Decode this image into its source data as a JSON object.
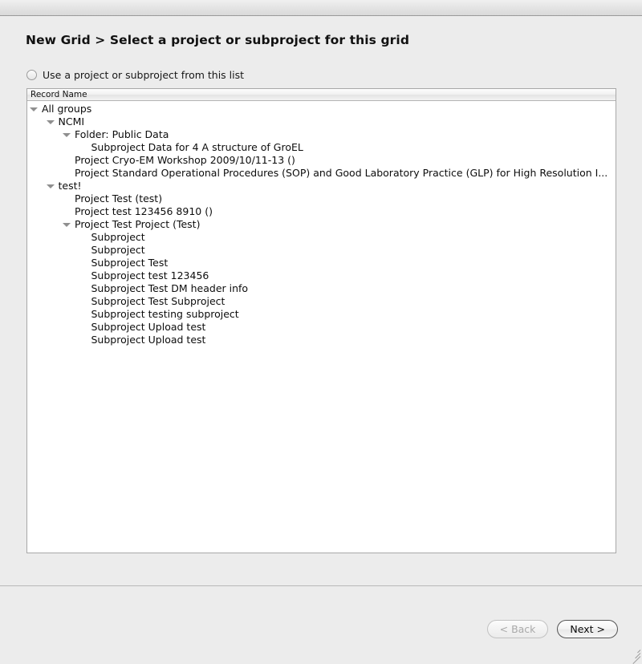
{
  "window": {
    "titlebar_visible": true
  },
  "header": {
    "title": "New Grid > Select a project or subproject for this grid"
  },
  "radio_option": {
    "label": "Use a project or subproject from this list",
    "selected": false,
    "icon": "radio-unchecked-icon"
  },
  "list": {
    "column_header": "Record Name",
    "rows": [
      {
        "label": "All groups",
        "level": 0,
        "expander": "triangle-down-icon",
        "expanded": true
      },
      {
        "label": "NCMI",
        "level": 1,
        "expander": "triangle-down-icon",
        "expanded": true
      },
      {
        "label": "Folder: Public Data",
        "level": 2,
        "expander": "triangle-down-icon",
        "expanded": true
      },
      {
        "label": "Subproject Data for 4 A structure of GroEL",
        "level": 3,
        "expander": "none",
        "expanded": false
      },
      {
        "label": "Project Cryo-EM Workshop 2009/10/11-13 ()",
        "level": 2,
        "expander": "none",
        "expanded": false
      },
      {
        "label": "Project Standard Operational Procedures (SOP) and Good Laboratory Practice (GLP) for High Resolution I...",
        "level": 2,
        "expander": "none",
        "expanded": false
      },
      {
        "label": "test!",
        "level": 1,
        "expander": "triangle-down-icon",
        "expanded": true
      },
      {
        "label": "Project Test (test)",
        "level": 2,
        "expander": "none",
        "expanded": false
      },
      {
        "label": "Project test 123456 8910 ()",
        "level": 2,
        "expander": "none",
        "expanded": false
      },
      {
        "label": "Project Test Project (Test)",
        "level": 2,
        "expander": "triangle-down-icon",
        "expanded": true
      },
      {
        "label": "Subproject",
        "level": 3,
        "expander": "none",
        "expanded": false
      },
      {
        "label": "Subproject",
        "level": 3,
        "expander": "none",
        "expanded": false
      },
      {
        "label": "Subproject Test",
        "level": 3,
        "expander": "none",
        "expanded": false
      },
      {
        "label": "Subproject test 123456",
        "level": 3,
        "expander": "none",
        "expanded": false
      },
      {
        "label": "Subproject Test DM header info",
        "level": 3,
        "expander": "none",
        "expanded": false
      },
      {
        "label": "Subproject Test Subproject",
        "level": 3,
        "expander": "none",
        "expanded": false
      },
      {
        "label": "Subproject testing subproject",
        "level": 3,
        "expander": "none",
        "expanded": false
      },
      {
        "label": "Subproject Upload test",
        "level": 3,
        "expander": "none",
        "expanded": false
      },
      {
        "label": "Subproject Upload test",
        "level": 3,
        "expander": "none",
        "expanded": false
      }
    ]
  },
  "footer": {
    "back_label": "< Back",
    "back_enabled": false,
    "next_label": "Next >",
    "next_enabled": true
  },
  "colors": {
    "window_background": "#ececec",
    "panel_background": "#ffffff",
    "panel_border": "#a8a8a8",
    "separator": "#b9b9b9",
    "text": "#0d0d0d",
    "disabled_text": "#a9a9a9",
    "triangle": "#8f8f8f"
  }
}
